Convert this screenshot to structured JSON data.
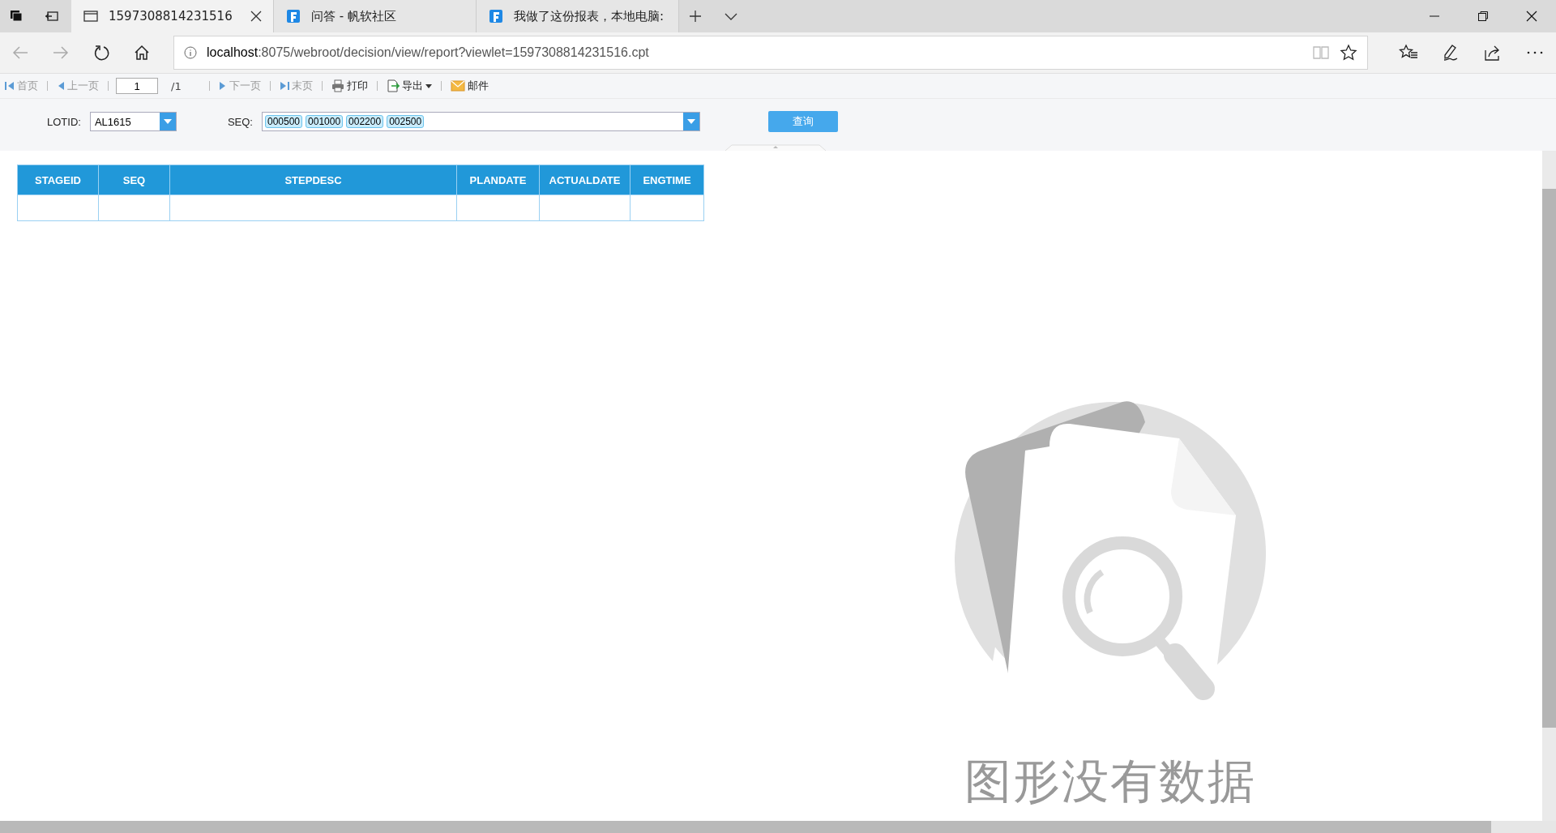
{
  "tabs": [
    {
      "title": "1597308814231516",
      "selected": true,
      "kind": "page"
    },
    {
      "title": "问答 - 帆软社区",
      "selected": false,
      "kind": "site"
    },
    {
      "title": "我做了这份报表，本地电脑:",
      "selected": false,
      "kind": "site"
    }
  ],
  "address_bar": {
    "host": "localhost",
    "path": ":8075/webroot/decision/view/report?viewlet=1597308814231516.cpt"
  },
  "report_toolbar": {
    "items": [
      {
        "label": "首页",
        "kind": "first",
        "disabled": true
      },
      {
        "label": "上一页",
        "kind": "prev",
        "disabled": true
      },
      {
        "kind": "page",
        "value": "1",
        "total": "/1"
      },
      {
        "label": "下一页",
        "kind": "next",
        "disabled": true
      },
      {
        "label": "末页",
        "kind": "last",
        "disabled": true
      },
      {
        "label": "打印",
        "kind": "print",
        "disabled": false
      },
      {
        "label": "导出",
        "kind": "export",
        "disabled": false
      },
      {
        "label": "邮件",
        "kind": "mail",
        "disabled": false
      }
    ]
  },
  "parameters": {
    "lotid": {
      "label": "LOTID:",
      "value": "AL1615"
    },
    "seq": {
      "label": "SEQ:",
      "tags": [
        "000500",
        "001000",
        "002200",
        "002500"
      ]
    },
    "query_button": "查询"
  },
  "table": {
    "columns": [
      "STAGEID",
      "SEQ",
      "STEPDESC",
      "PLANDATE",
      "ACTUALDATE",
      "ENGTIME"
    ]
  },
  "empty_chart": {
    "message": "图形没有数据"
  }
}
